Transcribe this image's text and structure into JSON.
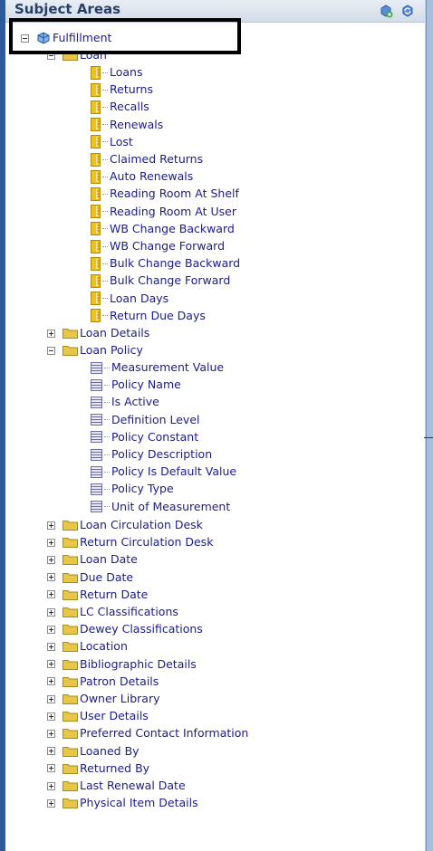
{
  "header": {
    "title": "Subject Areas"
  },
  "root": {
    "label": "Fulfillment"
  },
  "loan_folder": {
    "label": "Loan"
  },
  "loan_measures": [
    "Loans",
    "Returns",
    "Recalls",
    "Renewals",
    "Lost",
    "Claimed Returns",
    "Auto Renewals",
    "Reading Room At Shelf",
    "Reading Room At User",
    "WB Change Backward",
    "WB Change Forward",
    "Bulk Change Backward",
    "Bulk Change Forward",
    "Loan Days",
    "Return Due Days"
  ],
  "loan_details": {
    "label": "Loan Details"
  },
  "loan_policy": {
    "label": "Loan Policy"
  },
  "loan_policy_attributes": [
    "Measurement Value",
    "Policy Name",
    "Is Active",
    "Definition Level",
    "Policy Constant",
    "Policy Description",
    "Policy Is Default Value",
    "Policy Type",
    "Unit of Measurement"
  ],
  "folders": [
    "Loan Circulation Desk",
    "Return Circulation Desk",
    "Loan Date",
    "Due Date",
    "Return Date",
    "LC Classifications",
    "Dewey Classifications",
    "Location",
    "Bibliographic Details",
    "Patron Details",
    "Owner Library",
    "User Details",
    "Preferred Contact Information",
    "Loaned By",
    "Returned By",
    "Last Renewal Date",
    "Physical Item Details"
  ],
  "colors": {
    "accent": "#2d5b9a",
    "text": "#1b1b8a",
    "folder": "#e8c64a",
    "measure": "#f2c118"
  }
}
